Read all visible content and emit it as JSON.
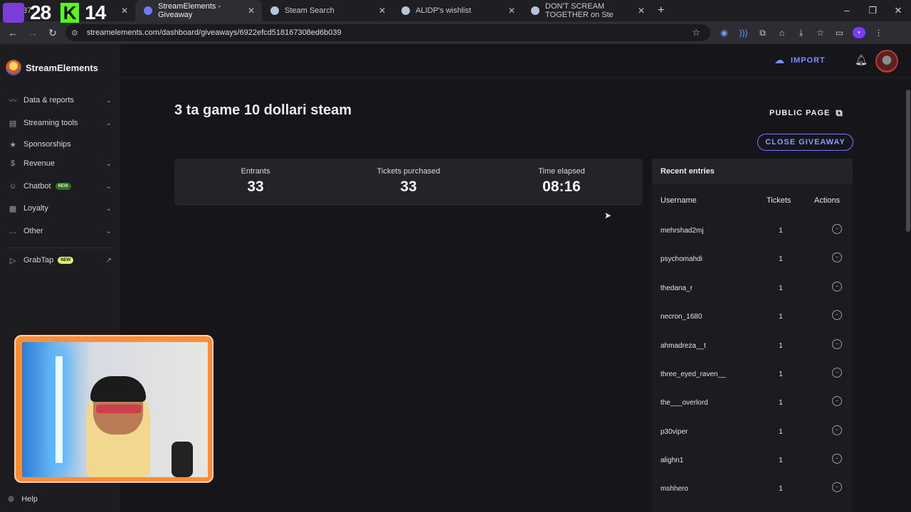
{
  "browser": {
    "tabs": [
      {
        "label": "37",
        "close": "✕"
      },
      {
        "label": "StreamElements - Giveaway",
        "close": "✕",
        "active": true
      },
      {
        "label": "Steam Search",
        "close": "✕"
      },
      {
        "label": "ALIDP's wishlist",
        "close": "✕"
      },
      {
        "label": "DON'T SCREAM TOGETHER on Ste",
        "close": "✕"
      }
    ],
    "url": "streamelements.com/dashboard/giveaways/6922efcd518167308ed6b039",
    "new_tab": "+",
    "window_controls": [
      "–",
      "❐",
      "✕"
    ]
  },
  "stream_overlay": {
    "counter_a": "28",
    "counter_b": "14",
    "k_glyph": "K"
  },
  "brand": {
    "name": "StreamElements"
  },
  "sidebar": {
    "items": [
      {
        "label": "Data & reports",
        "icon": "chart-line-icon",
        "chevron": "⌄"
      },
      {
        "label": "Streaming tools",
        "icon": "layout-icon",
        "chevron": "⌄"
      },
      {
        "label": "Sponsorships",
        "icon": "star-icon"
      },
      {
        "label": "Revenue",
        "icon": "dollar-icon",
        "chevron": "⌄"
      },
      {
        "label": "Chatbot",
        "icon": "robot-icon",
        "badge": "NEW",
        "chevron": "⌄"
      },
      {
        "label": "Loyalty",
        "icon": "loyalty-icon",
        "chevron": "⌄"
      },
      {
        "label": "Other",
        "icon": "more-icon",
        "chevron": "⌄"
      },
      {
        "label": "GrabTap",
        "icon": "grabtap-icon",
        "badge": "NEW"
      }
    ],
    "help": "Help"
  },
  "header": {
    "import_label": "IMPORT"
  },
  "giveaway": {
    "title": "3 ta game 10 dollari steam",
    "public_page": "PUBLIC PAGE",
    "close_button": "CLOSE GIVEAWAY",
    "stats": [
      {
        "label": "Entrants",
        "value": "33"
      },
      {
        "label": "Tickets purchased",
        "value": "33"
      },
      {
        "label": "Time elapsed",
        "value": "08:16"
      }
    ]
  },
  "entries": {
    "title": "Recent entries",
    "columns": {
      "username": "Username",
      "tickets": "Tickets",
      "actions": "Actions"
    },
    "rows": [
      {
        "username": "mehrshad2mj",
        "tickets": "1"
      },
      {
        "username": "psychomahdi",
        "tickets": "1"
      },
      {
        "username": "thedana_r",
        "tickets": "1"
      },
      {
        "username": "necron_1680",
        "tickets": "1"
      },
      {
        "username": "ahmadreza__t",
        "tickets": "1"
      },
      {
        "username": "three_eyed_raven__",
        "tickets": "1"
      },
      {
        "username": "the___overlord",
        "tickets": "1"
      },
      {
        "username": "p30viper",
        "tickets": "1"
      },
      {
        "username": "alighn1",
        "tickets": "1"
      },
      {
        "username": "mshhero",
        "tickets": "1"
      }
    ]
  },
  "colors": {
    "accent": "#7d8dff",
    "sidebar_bg": "#1d1d21",
    "main_bg": "#16161a",
    "card_bg": "#232328"
  }
}
